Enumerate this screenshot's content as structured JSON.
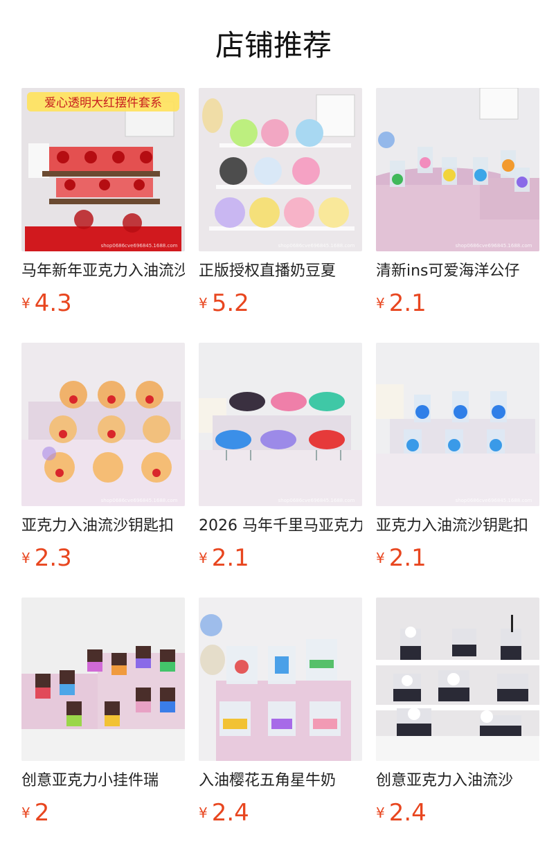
{
  "page_title": "店铺推荐",
  "accent_color": "#e8461f",
  "currency_symbol": "¥",
  "products": [
    {
      "name": "马年新年亚克力入油流沙",
      "price": "4.3",
      "image_label": "爱心透明大红摆件套系",
      "image_watermark": "shop0686cve696845.1688.com",
      "theme": "red-hearts"
    },
    {
      "name": "正版授权直播奶豆夏",
      "price": "5.2",
      "image_watermark": "shop0686cve696845.1688.com",
      "theme": "doll-faces"
    },
    {
      "name": "清新ins可爱海洋公仔",
      "price": "2.1",
      "image_watermark": "shop0686cve696845.1688.com",
      "theme": "ocean-cubes"
    },
    {
      "name": "亚克力入油流沙钥匙扣",
      "price": "2.3",
      "image_watermark": "shop0686cve696845.1688.com",
      "theme": "bears"
    },
    {
      "name": "2026 马年千里马亚克力",
      "price": "2.1",
      "image_watermark": "shop0686cve696845.1688.com",
      "theme": "horses"
    },
    {
      "name": "亚克力入油流沙钥匙扣",
      "price": "2.1",
      "image_watermark": "shop0686cve696845.1688.com",
      "theme": "blue-animals"
    },
    {
      "name": "创意亚克力小挂件瑞",
      "price": "2",
      "theme": "bubble-tea"
    },
    {
      "name": "入油樱花五角星牛奶",
      "price": "2.4",
      "theme": "milk-boxes"
    },
    {
      "name": "创意亚克力入油流沙",
      "price": "2.4",
      "theme": "pandas"
    }
  ]
}
